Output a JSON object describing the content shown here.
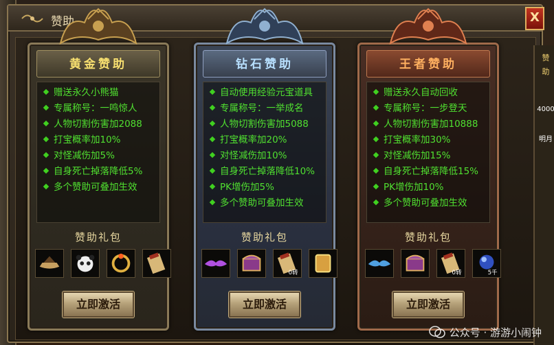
{
  "window": {
    "title": "赞助",
    "close_label": "X"
  },
  "side_strip": {
    "labels": [
      "赞",
      "助",
      "4000",
      "明月"
    ]
  },
  "tiers": [
    {
      "name": "黄金赞助",
      "color": "#f8e070",
      "benefits": [
        "赠送永久小熊猫",
        "专属称号：一鸣惊人",
        "人物切割伤害加2088",
        "打宝概率加10%",
        "对怪减伤加5%",
        "自身死亡掉落降低5%",
        "多个赞助可叠加生效"
      ],
      "gift_title": "赞助礼包",
      "gifts": [
        {
          "icon": "boat-icon"
        },
        {
          "icon": "panda-icon"
        },
        {
          "icon": "ring-icon"
        },
        {
          "icon": "scroll-icon"
        }
      ],
      "button": "立即激活"
    },
    {
      "name": "钻石赞助",
      "color": "#b8e0ff",
      "benefits": [
        "自动使用经验元宝道具",
        "专属称号：一举成名",
        "人物切割伤害加5088",
        "打宝概率加20%",
        "对怪减伤加10%",
        "自身死亡掉落降低10%",
        "PK增伤加5%",
        "多个赞助可叠加生效"
      ],
      "gift_title": "赞助礼包",
      "gifts": [
        {
          "icon": "purple-wing-icon"
        },
        {
          "icon": "chest-icon"
        },
        {
          "icon": "scroll-icon",
          "text": "0转"
        },
        {
          "icon": "gold-box-icon"
        }
      ],
      "button": "立即激活"
    },
    {
      "name": "王者赞助",
      "color": "#ffb060",
      "benefits": [
        "赠送永久自动回收",
        "专属称号：一步登天",
        "人物切割伤害加10888",
        "打宝概率加30%",
        "对怪减伤加15%",
        "自身死亡掉落降低15%",
        "PK增伤加10%",
        "多个赞助可叠加生效"
      ],
      "gift_title": "赞助礼包",
      "gifts": [
        {
          "icon": "blue-wing-icon"
        },
        {
          "icon": "chest-icon"
        },
        {
          "icon": "scroll-icon",
          "text": "0转"
        },
        {
          "icon": "orb-icon",
          "text": "5千"
        }
      ],
      "button": "立即激活"
    }
  ],
  "watermark": {
    "text": "公众号 · 游游小闹钟"
  }
}
